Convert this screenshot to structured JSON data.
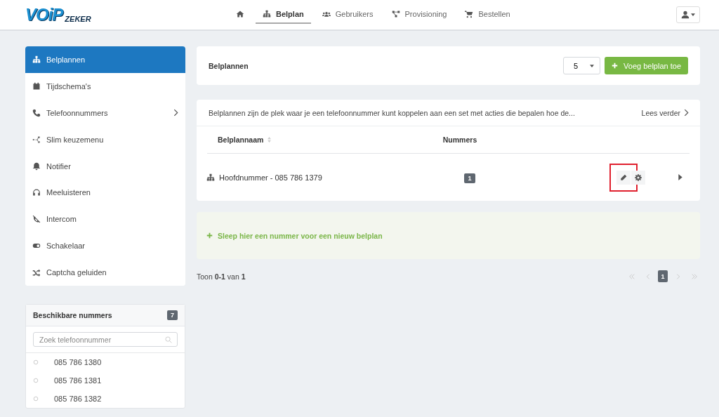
{
  "header": {
    "logo": {
      "main": "VOiP",
      "sub": "ZEKER"
    },
    "nav": [
      {
        "kind": "home",
        "selected": false
      },
      {
        "kind": "sitemap",
        "label": "Belplan",
        "selected": true
      },
      {
        "kind": "users",
        "label": "Gebruikers",
        "selected": false
      },
      {
        "kind": "nodes",
        "label": "Provisioning",
        "selected": false
      },
      {
        "kind": "cart",
        "label": "Bestellen",
        "selected": false
      }
    ]
  },
  "sidebar": {
    "items": [
      {
        "kind": "sitemap",
        "label": "Belplannen",
        "selected": true,
        "submenu": false
      },
      {
        "kind": "calendar",
        "label": "Tijdschema's",
        "selected": false,
        "submenu": false
      },
      {
        "kind": "phone",
        "label": "Telefoonnummers",
        "selected": false,
        "submenu": true
      },
      {
        "kind": "branch",
        "label": "Slim keuzemenu",
        "selected": false,
        "submenu": false
      },
      {
        "kind": "bell",
        "label": "Notifier",
        "selected": false,
        "submenu": false
      },
      {
        "kind": "headphones",
        "label": "Meeluisteren",
        "selected": false,
        "submenu": false
      },
      {
        "kind": "phone-off",
        "label": "Intercom",
        "selected": false,
        "submenu": false
      },
      {
        "kind": "toggle",
        "label": "Schakelaar",
        "selected": false,
        "submenu": false
      },
      {
        "kind": "shuffle",
        "label": "Captcha geluiden",
        "selected": false,
        "submenu": false
      }
    ]
  },
  "numbers_panel": {
    "title": "Beschikbare nummers",
    "count": "7",
    "search": {
      "placeholder": "Zoek telefoonnummer"
    },
    "items": [
      "085 786 1380",
      "085 786 1381",
      "085 786 1382"
    ]
  },
  "toolbar": {
    "title": "Belplannen",
    "page_size": "5",
    "add_button": "Voeg belplan toe"
  },
  "info": {
    "text": "Belplannen zijn de plek waar je een telefoonnummer kunt koppelen aan een set met acties die bepalen hoe de...",
    "link": "Lees verder"
  },
  "table": {
    "columns": [
      {
        "label": "Belplannaam",
        "sortable": true
      },
      {
        "label": "Nummers",
        "sortable": false
      }
    ],
    "rows": [
      {
        "name": "Hoofdnummer - 085 786 1379",
        "count": "1",
        "edit_highlighted": true
      }
    ]
  },
  "drop_zone": {
    "text": "Sleep hier een nummer voor een nieuw belplan"
  },
  "pagination": {
    "summary": "Toon **0-1** van **1**",
    "pages": [
      {
        "kind": "first",
        "disabled": true
      },
      {
        "kind": "prev",
        "disabled": true
      },
      {
        "kind": "page",
        "label": "1",
        "selected": true
      },
      {
        "kind": "next",
        "disabled": true
      },
      {
        "kind": "last",
        "disabled": true
      }
    ]
  }
}
